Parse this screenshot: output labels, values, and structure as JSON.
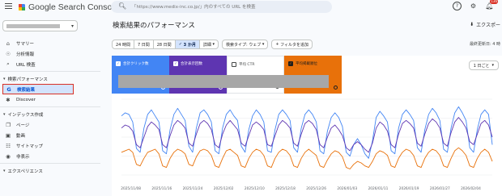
{
  "header": {
    "app_name": "Google Search Console",
    "search_placeholder": "「https://www.medix-inc.co.jp/」内のすべての URL を検査",
    "notification_count": "136"
  },
  "sidebar": {
    "items": [
      {
        "type": "item",
        "label": "サマリー",
        "icon": "home-icon"
      },
      {
        "type": "item",
        "label": "分析情報",
        "icon": "lightbulb-icon"
      },
      {
        "type": "item",
        "label": "URL 検査",
        "icon": "search-icon"
      },
      {
        "type": "section",
        "label": "検索パフォーマンス"
      },
      {
        "type": "item",
        "label": "検索結果",
        "icon": "google-g-icon",
        "active": true
      },
      {
        "type": "item",
        "label": "Discover",
        "icon": "asterisk-icon"
      },
      {
        "type": "section",
        "label": "インデックス作成"
      },
      {
        "type": "item",
        "label": "ページ",
        "icon": "page-icon"
      },
      {
        "type": "item",
        "label": "動画",
        "icon": "video-icon"
      },
      {
        "type": "item",
        "label": "サイトマップ",
        "icon": "sitemap-icon"
      },
      {
        "type": "item",
        "label": "非表示",
        "icon": "eye-off-icon"
      },
      {
        "type": "section",
        "label": "エクスペリエンス"
      }
    ]
  },
  "main": {
    "title": "検索結果のパフォーマンス",
    "export_label": "エクスポー",
    "updated": "最終更新日: 4 時",
    "date_chips": [
      "24 時間",
      "7 日間",
      "28 日間",
      "3 か月",
      "詳細"
    ],
    "selected_chip": "3 か月",
    "search_type": "検索タイプ: ウェブ",
    "add_filter": "フィルタを追加",
    "period_select": "1 日ごと"
  },
  "metrics": [
    {
      "label": "合計クリック数",
      "checked": true,
      "color": "#4285f4"
    },
    {
      "label": "合計表示回数",
      "checked": true,
      "color": "#5e35b1"
    },
    {
      "label": "平均 CTR",
      "checked": false,
      "color": "#ffffff"
    },
    {
      "label": "平均掲載順位",
      "checked": true,
      "color": "#e8710a"
    }
  ],
  "chart_data": {
    "type": "line",
    "x_ticks": [
      "2025/11/08",
      "2025/11/16",
      "2025/11/24",
      "2025/12/02",
      "2025/12/10",
      "2025/12/18",
      "2025/12/26",
      "2026/01/03",
      "2026/01/11",
      "2026/01/19",
      "2026/01/27",
      "2026/02/04"
    ],
    "grid": true,
    "series": [
      {
        "name": "合計クリック数",
        "color": "#4285f4",
        "values": [
          0.78,
          0.82,
          0.8,
          0.7,
          0.35,
          0.3,
          0.62,
          0.8,
          0.86,
          0.78,
          0.7,
          0.32,
          0.28,
          0.6,
          0.8,
          0.88,
          0.8,
          0.72,
          0.38,
          0.3,
          0.62,
          0.82,
          0.86,
          0.8,
          0.7,
          0.32,
          0.28,
          0.62,
          0.8,
          0.86,
          0.78,
          0.72,
          0.38,
          0.3,
          0.6,
          0.78,
          0.86,
          0.8,
          0.7,
          0.32,
          0.3,
          0.6,
          0.8,
          0.86,
          0.8,
          0.72,
          0.36,
          0.3,
          0.62,
          0.8,
          0.86,
          0.8,
          0.7,
          0.32,
          0.28,
          0.58,
          0.76,
          0.82,
          0.76,
          0.64,
          0.3,
          0.25,
          0.4,
          0.48,
          0.4,
          0.28,
          0.22,
          0.45,
          0.76,
          0.84,
          0.78,
          0.7,
          0.32,
          0.28,
          0.62,
          0.8,
          0.86,
          0.8,
          0.72,
          0.36,
          0.3,
          0.6,
          0.8,
          0.88,
          0.82,
          0.72,
          0.34,
          0.3,
          0.62,
          0.82,
          0.9,
          0.82,
          0.72,
          0.36,
          0.3,
          0.6,
          0.8,
          0.86,
          0.8,
          0.4
        ]
      },
      {
        "name": "合計表示回数",
        "color": "#5e35b1",
        "values": [
          0.62,
          0.66,
          0.64,
          0.58,
          0.4,
          0.36,
          0.5,
          0.64,
          0.7,
          0.66,
          0.6,
          0.4,
          0.36,
          0.52,
          0.66,
          0.72,
          0.68,
          0.62,
          0.42,
          0.38,
          0.54,
          0.68,
          0.72,
          0.68,
          0.6,
          0.4,
          0.36,
          0.54,
          0.66,
          0.72,
          0.66,
          0.6,
          0.42,
          0.38,
          0.52,
          0.66,
          0.7,
          0.66,
          0.6,
          0.4,
          0.38,
          0.52,
          0.66,
          0.72,
          0.68,
          0.62,
          0.42,
          0.38,
          0.54,
          0.68,
          0.72,
          0.68,
          0.6,
          0.4,
          0.36,
          0.5,
          0.62,
          0.66,
          0.6,
          0.52,
          0.36,
          0.32,
          0.4,
          0.44,
          0.4,
          0.34,
          0.3,
          0.42,
          0.62,
          0.7,
          0.66,
          0.58,
          0.4,
          0.36,
          0.54,
          0.68,
          0.72,
          0.68,
          0.62,
          0.42,
          0.38,
          0.54,
          0.68,
          0.74,
          0.7,
          0.62,
          0.42,
          0.38,
          0.56,
          0.7,
          0.76,
          0.7,
          0.62,
          0.44,
          0.4,
          0.54,
          0.68,
          0.72,
          0.66,
          0.5
        ]
      },
      {
        "name": "平均掲載順位",
        "color": "#e8710a",
        "values": [
          0.3,
          0.32,
          0.34,
          0.3,
          0.14,
          0.12,
          0.22,
          0.3,
          0.32,
          0.34,
          0.28,
          0.12,
          0.1,
          0.22,
          0.3,
          0.34,
          0.32,
          0.28,
          0.14,
          0.12,
          0.24,
          0.32,
          0.34,
          0.32,
          0.26,
          0.12,
          0.1,
          0.22,
          0.32,
          0.34,
          0.3,
          0.26,
          0.12,
          0.1,
          0.22,
          0.3,
          0.34,
          0.32,
          0.26,
          0.12,
          0.1,
          0.22,
          0.3,
          0.34,
          0.32,
          0.26,
          0.12,
          0.1,
          0.22,
          0.3,
          0.34,
          0.3,
          0.26,
          0.12,
          0.1,
          0.2,
          0.28,
          0.32,
          0.3,
          0.24,
          0.1,
          0.08,
          0.14,
          0.18,
          0.16,
          0.12,
          0.1,
          0.18,
          0.28,
          0.32,
          0.3,
          0.26,
          0.12,
          0.1,
          0.22,
          0.3,
          0.34,
          0.32,
          0.26,
          0.12,
          0.1,
          0.22,
          0.3,
          0.34,
          0.32,
          0.26,
          0.12,
          0.1,
          0.22,
          0.32,
          0.36,
          0.32,
          0.26,
          0.12,
          0.1,
          0.22,
          0.3,
          0.34,
          0.3,
          0.18
        ]
      }
    ]
  }
}
